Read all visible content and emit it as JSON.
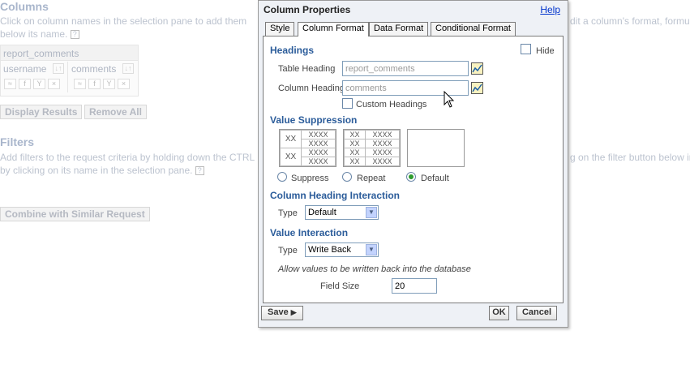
{
  "background": {
    "columns_title": "Columns",
    "columns_hint_line1": "Click on column names in the selection pane to add them",
    "columns_hint_right": "dit a column's format, formu",
    "columns_hint_line2": "below its name.",
    "table_name": "report_comments",
    "col1_name": "username",
    "col2_name": "comments",
    "display_results": "Display Results",
    "remove_all": "Remove All",
    "filters_title": "Filters",
    "filters_hint_line1": "Add filters to the request criteria by holding down the CTRL",
    "filters_hint_right": "g on the filter button below in",
    "filters_hint_line2": "by clicking on its name in the selection pane.",
    "combine_button": "Combine with Similar Request"
  },
  "dialog": {
    "title": "Column Properties",
    "help": "Help",
    "tabs": [
      "Style",
      "Column Format",
      "Data Format",
      "Conditional Format"
    ],
    "active_tab": "Column Format",
    "headings_label": "Headings",
    "hide_label": "Hide",
    "table_heading_label": "Table Heading",
    "table_heading_value": "report_comments",
    "column_heading_label": "Column Heading",
    "column_heading_value": "comments",
    "custom_headings_label": "Custom Headings",
    "value_suppression_label": "Value Suppression",
    "sample_xx": "XX",
    "sample_xxxx": "XXXX",
    "suppress_label": "Suppress",
    "repeat_label": "Repeat",
    "default_label": "Default",
    "selected_suppression": "Default",
    "col_heading_interaction_label": "Column Heading Interaction",
    "type_label": "Type",
    "col_heading_interaction_value": "Default",
    "value_interaction_label": "Value Interaction",
    "value_interaction_value": "Write Back",
    "allow_text": "Allow values to be written back into the database",
    "field_size_label": "Field Size",
    "field_size_value": "20",
    "save_label": "Save",
    "ok_label": "OK",
    "cancel_label": "Cancel"
  }
}
